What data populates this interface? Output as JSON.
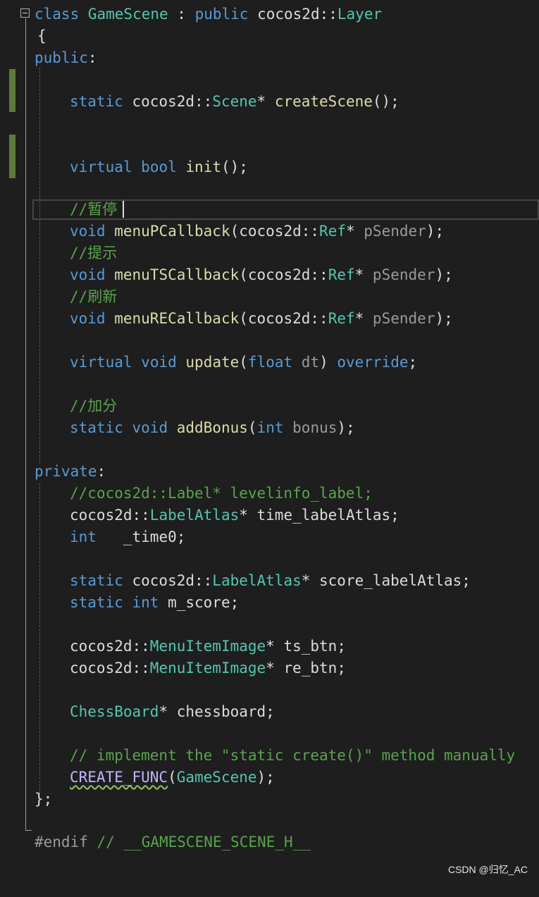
{
  "editor": {
    "lines": {
      "l1": {
        "t1": "class ",
        "t2": "GameScene",
        "t3": " : ",
        "t4": "public",
        "t5": " cocos2d::",
        "t6": "Layer"
      },
      "l2": {
        "t1": "{"
      },
      "l3": {
        "t1": "public",
        "t2": ":"
      },
      "l5": {
        "t1": "static",
        "t2": " cocos2d::",
        "t3": "Scene",
        "t4": "* ",
        "t5": "createScene",
        "t6": "();"
      },
      "l8": {
        "t1": "virtual",
        "t2": " ",
        "t3": "bool",
        "t4": " ",
        "t5": "init",
        "t6": "();"
      },
      "l10": {
        "t1": "//暂停"
      },
      "l11": {
        "t1": "void",
        "t2": " ",
        "t3": "menuPCallback",
        "t4": "(cocos2d::",
        "t5": "Ref",
        "t6": "* ",
        "t7": "pSender",
        "t8": ");"
      },
      "l12": {
        "t1": "//提示"
      },
      "l13": {
        "t1": "void",
        "t2": " ",
        "t3": "menuTSCallback",
        "t4": "(cocos2d::",
        "t5": "Ref",
        "t6": "* ",
        "t7": "pSender",
        "t8": ");"
      },
      "l14": {
        "t1": "//刷新"
      },
      "l15": {
        "t1": "void",
        "t2": " ",
        "t3": "menuRECallback",
        "t4": "(cocos2d::",
        "t5": "Ref",
        "t6": "* ",
        "t7": "pSender",
        "t8": ");"
      },
      "l17": {
        "t1": "virtual",
        "t2": " ",
        "t3": "void",
        "t4": " ",
        "t5": "update",
        "t6": "(",
        "t7": "float",
        "t8": " ",
        "t9": "dt",
        "t10": ") ",
        "t11": "override",
        "t12": ";"
      },
      "l19": {
        "t1": "//加分"
      },
      "l20": {
        "t1": "static",
        "t2": " ",
        "t3": "void",
        "t4": " ",
        "t5": "addBonus",
        "t6": "(",
        "t7": "int",
        "t8": " ",
        "t9": "bonus",
        "t10": ");"
      },
      "l22": {
        "t1": "private",
        "t2": ":"
      },
      "l23": {
        "t1": "//cocos2d::Label* levelinfo_label;"
      },
      "l24": {
        "t1": "cocos2d::",
        "t2": "LabelAtlas",
        "t3": "* time_labelAtlas;"
      },
      "l25": {
        "t1": "int",
        "t2": "   _time0;"
      },
      "l27": {
        "t1": "static",
        "t2": " cocos2d::",
        "t3": "LabelAtlas",
        "t4": "* score_labelAtlas;"
      },
      "l28": {
        "t1": "static",
        "t2": " ",
        "t3": "int",
        "t4": " m_score;"
      },
      "l30": {
        "t1": "cocos2d::",
        "t2": "MenuItemImage",
        "t3": "* ts_btn;"
      },
      "l31": {
        "t1": "cocos2d::",
        "t2": "MenuItemImage",
        "t3": "* re_btn;"
      },
      "l33": {
        "t1": "ChessBoard",
        "t2": "* chessboard;"
      },
      "l35": {
        "t1": "// implement the \"static create()\" method manually"
      },
      "l36": {
        "t1": "CREATE_FUNC",
        "t2": "(",
        "t3": "GameScene",
        "t4": ");"
      },
      "l37": {
        "t1": "};"
      },
      "l39": {
        "t1": "#endif",
        "t2": " // __GAMESCENE_SCENE_H__"
      }
    }
  },
  "watermark": "CSDN @归忆_AC",
  "colors": {
    "background": "#1e1e1e",
    "keyword": "#569cd6",
    "type": "#4ec9b0",
    "function": "#dcdcaa",
    "comment": "#57a64a",
    "change_bar": "#5d7a36"
  }
}
